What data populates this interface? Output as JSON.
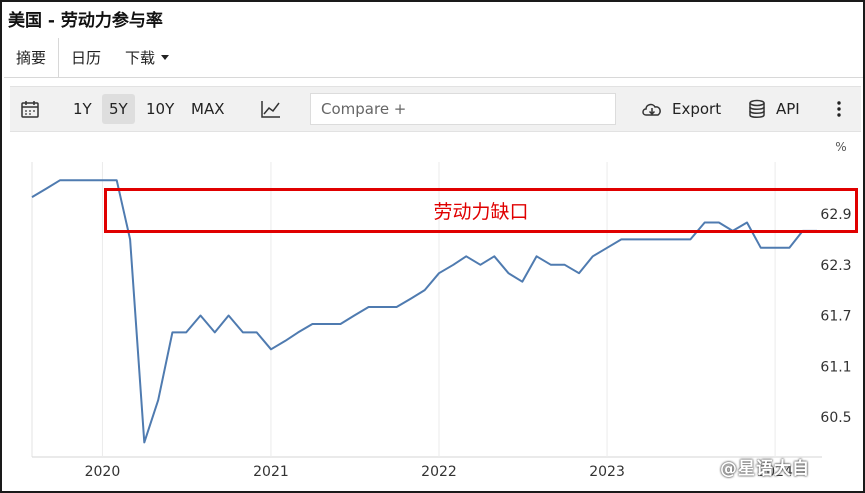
{
  "title": "美国 - 劳动力参与率",
  "tabs": [
    {
      "label": "摘要"
    },
    {
      "label": "日历"
    },
    {
      "label": "下载"
    }
  ],
  "toolbar": {
    "ranges": [
      "1Y",
      "5Y",
      "10Y",
      "MAX"
    ],
    "active_range": "5Y",
    "compare_placeholder": "Compare +",
    "export_label": "Export",
    "api_label": "API"
  },
  "annotation": "劳动力缺口",
  "watermark": "@星语大自",
  "colors": {
    "line": "#4f7bb0",
    "annotation": "#e00000",
    "toolbar_bg": "#f1f1f1"
  },
  "chart_data": {
    "type": "line",
    "unit": "%",
    "x": [
      "2019-08",
      "2019-09",
      "2019-10",
      "2019-11",
      "2019-12",
      "2020-01",
      "2020-02",
      "2020-03",
      "2020-04",
      "2020-05",
      "2020-06",
      "2020-07",
      "2020-08",
      "2020-09",
      "2020-10",
      "2020-11",
      "2020-12",
      "2021-01",
      "2021-02",
      "2021-03",
      "2021-04",
      "2021-05",
      "2021-06",
      "2021-07",
      "2021-08",
      "2021-09",
      "2021-10",
      "2021-11",
      "2021-12",
      "2022-01",
      "2022-02",
      "2022-03",
      "2022-04",
      "2022-05",
      "2022-06",
      "2022-07",
      "2022-08",
      "2022-09",
      "2022-10",
      "2022-11",
      "2022-12",
      "2023-01",
      "2023-02",
      "2023-03",
      "2023-04",
      "2023-05",
      "2023-06",
      "2023-07",
      "2023-08",
      "2023-09",
      "2023-10",
      "2023-11",
      "2023-12",
      "2024-01",
      "2024-02",
      "2024-03",
      "2024-04"
    ],
    "series": [
      {
        "values": [
          63.1,
          63.2,
          63.3,
          63.3,
          63.3,
          63.3,
          63.3,
          62.6,
          60.2,
          60.7,
          61.5,
          61.5,
          61.7,
          61.5,
          61.7,
          61.5,
          61.5,
          61.3,
          61.4,
          61.5,
          61.6,
          61.6,
          61.6,
          61.7,
          61.8,
          61.8,
          61.8,
          61.9,
          62.0,
          62.2,
          62.3,
          62.4,
          62.3,
          62.4,
          62.2,
          62.1,
          62.4,
          62.3,
          62.3,
          62.2,
          62.4,
          62.5,
          62.6,
          62.6,
          62.6,
          62.6,
          62.6,
          62.6,
          62.8,
          62.8,
          62.7,
          62.8,
          62.5,
          62.5,
          62.5,
          62.7,
          62.7
        ]
      }
    ],
    "x_ticks": [
      "2020",
      "2021",
      "2022",
      "2023",
      "2024"
    ],
    "y_ticks": [
      60.5,
      61.1,
      61.7,
      62.3,
      62.9
    ],
    "ylim": [
      60.1,
      63.3
    ],
    "legend": "none",
    "grid": "vertical"
  }
}
